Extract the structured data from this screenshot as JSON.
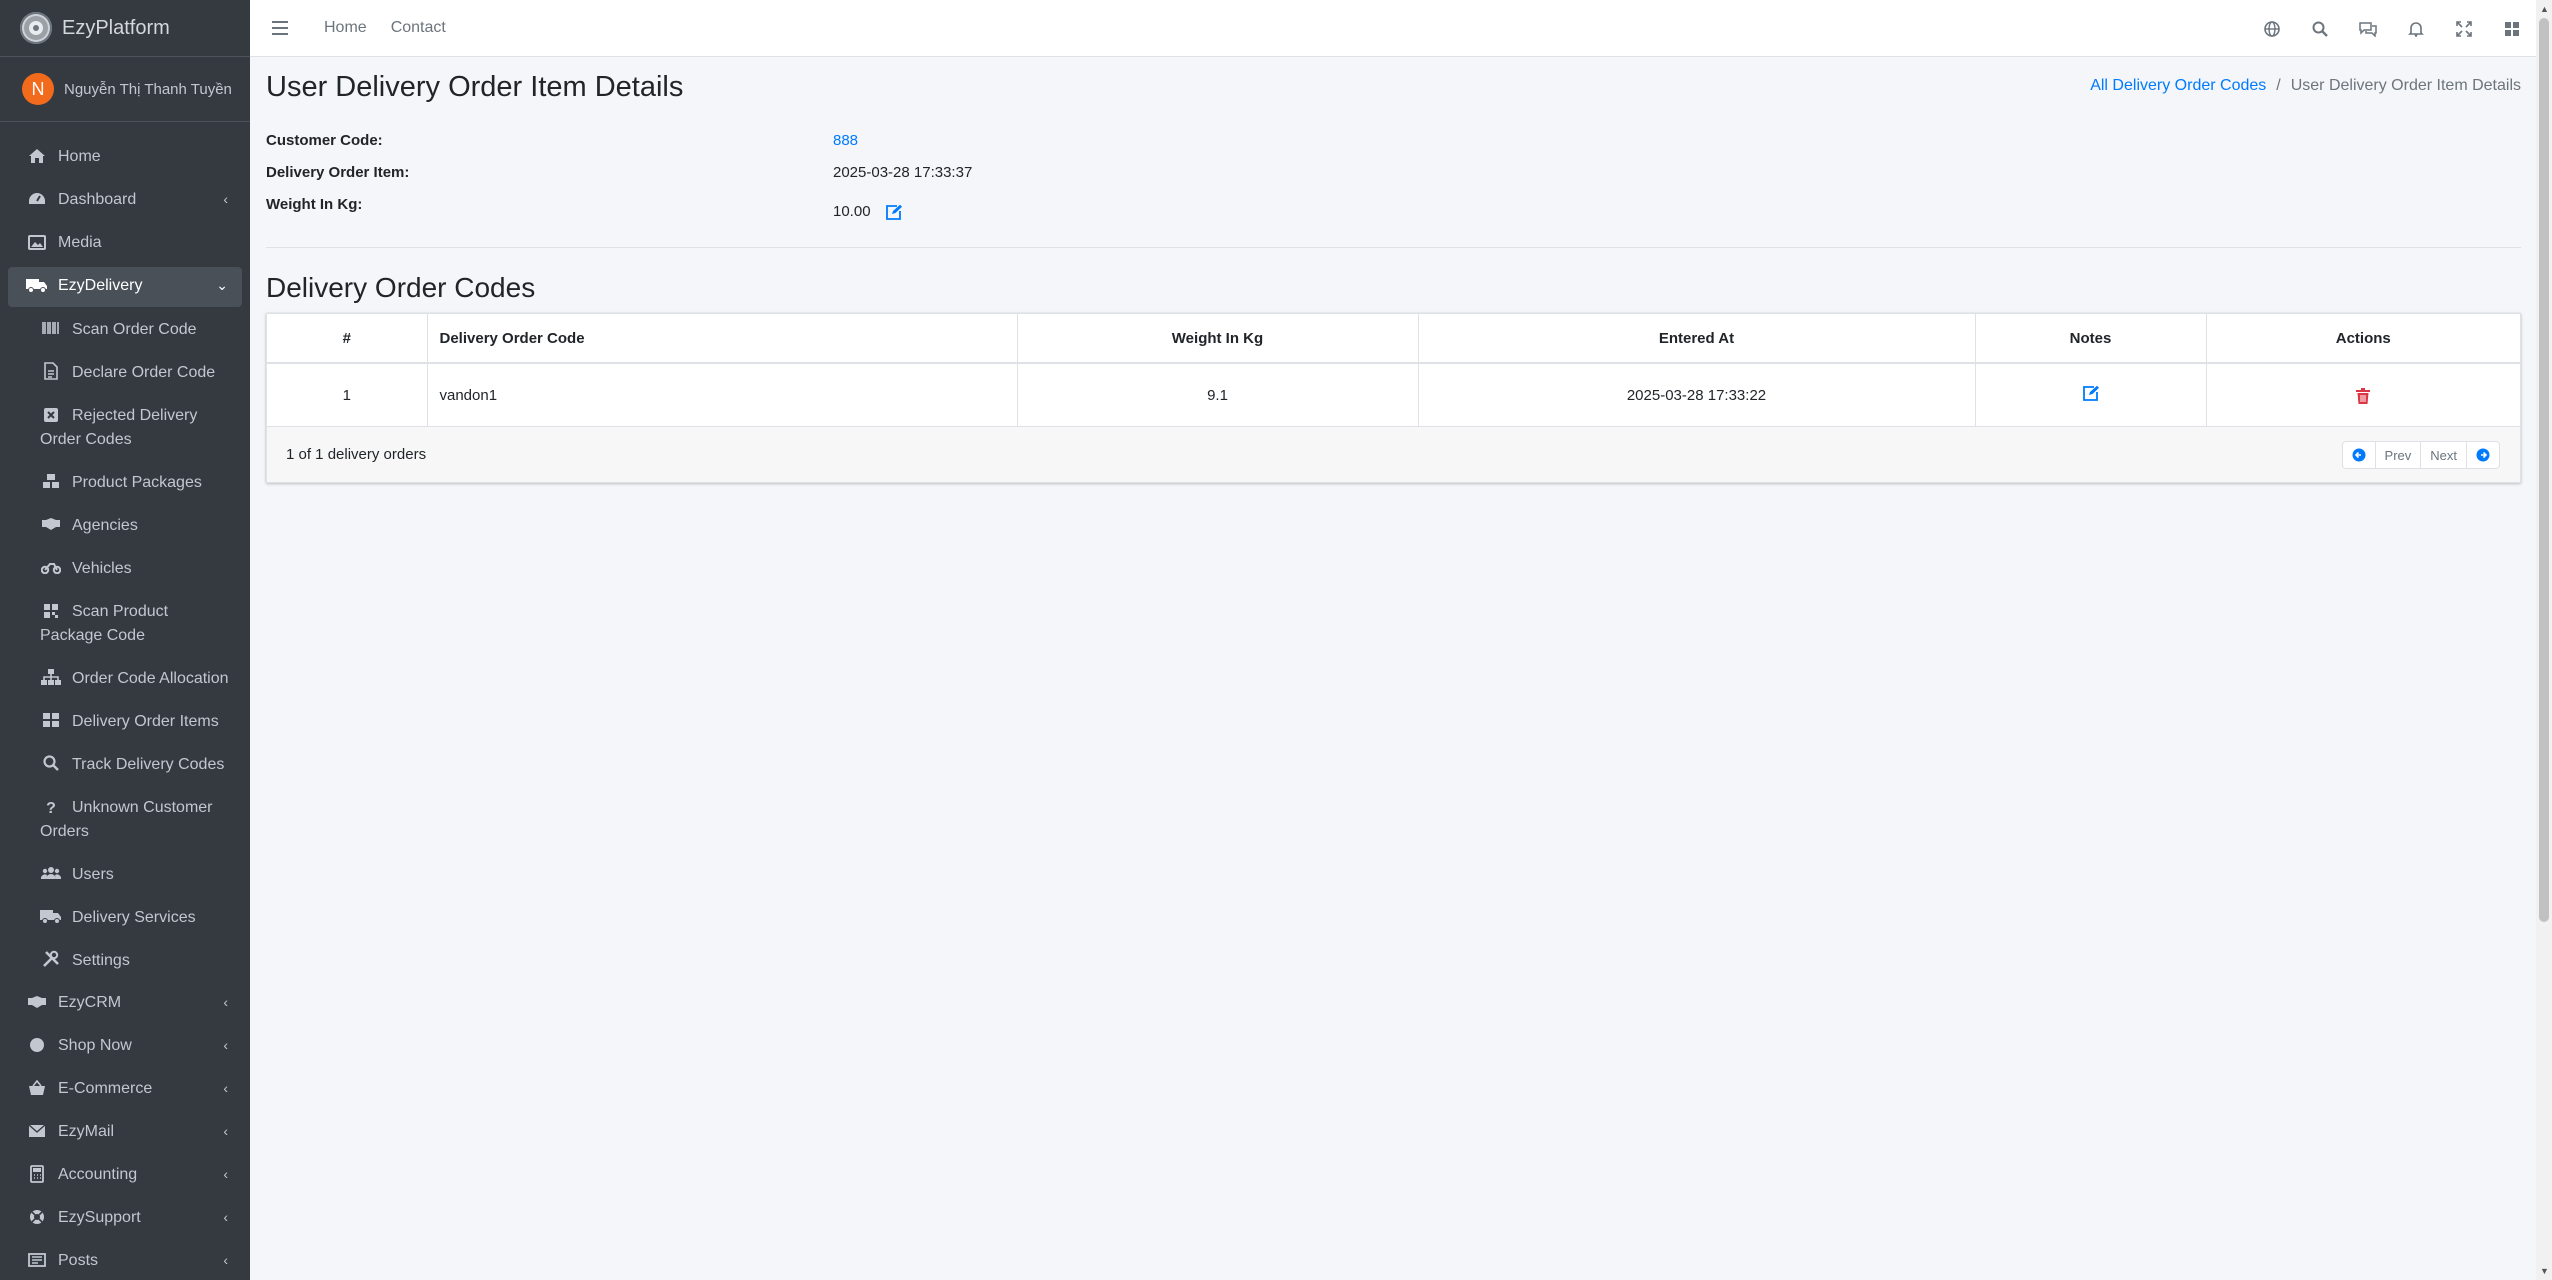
{
  "brand": {
    "name": "EzyPlatform"
  },
  "user": {
    "initial": "N",
    "name": "Nguyễn Thị Thanh Tuyền"
  },
  "sidebar": {
    "items": [
      {
        "label": "Home",
        "icon": "home-icon"
      },
      {
        "label": "Dashboard",
        "icon": "dashboard-icon",
        "expandable": true
      },
      {
        "label": "Media",
        "icon": "image-icon"
      },
      {
        "label": "EzyDelivery",
        "icon": "truck-icon",
        "expanded": true,
        "active": true
      },
      {
        "label": "Scan Order Code",
        "icon": "barcode-icon",
        "sub": true
      },
      {
        "label": "Declare Order Code",
        "icon": "file-icon",
        "sub": true
      },
      {
        "label": "Rejected Delivery Order Codes",
        "icon": "close-box-icon",
        "sub": true
      },
      {
        "label": "Product Packages",
        "icon": "boxes-icon",
        "sub": true
      },
      {
        "label": "Agencies",
        "icon": "handshake-icon",
        "sub": true
      },
      {
        "label": "Vehicles",
        "icon": "motorcycle-icon",
        "sub": true
      },
      {
        "label": "Scan Product Package Code",
        "icon": "qrcode-icon",
        "sub": true
      },
      {
        "label": "Order Code Allocation",
        "icon": "sitemap-icon",
        "sub": true
      },
      {
        "label": "Delivery Order Items",
        "icon": "grid-icon",
        "sub": true
      },
      {
        "label": "Track Delivery Codes",
        "icon": "search-icon",
        "sub": true
      },
      {
        "label": "Unknown Customer Orders",
        "icon": "question-icon",
        "sub": true
      },
      {
        "label": "Users",
        "icon": "users-icon",
        "sub": true
      },
      {
        "label": "Delivery Services",
        "icon": "truck-icon",
        "sub": true
      },
      {
        "label": "Settings",
        "icon": "tools-icon",
        "sub": true
      },
      {
        "label": "EzyCRM",
        "icon": "handshake-icon",
        "expandable": true
      },
      {
        "label": "Shop Now",
        "icon": "circle-icon",
        "expandable": true
      },
      {
        "label": "E-Commerce",
        "icon": "basket-icon",
        "expandable": true
      },
      {
        "label": "EzyMail",
        "icon": "envelope-icon",
        "expandable": true
      },
      {
        "label": "Accounting",
        "icon": "calculator-icon",
        "expandable": true
      },
      {
        "label": "EzySupport",
        "icon": "lifering-icon",
        "expandable": true
      },
      {
        "label": "Posts",
        "icon": "newspaper-icon",
        "expandable": true
      }
    ]
  },
  "topbar": {
    "home": "Home",
    "contact": "Contact"
  },
  "page": {
    "title": "User Delivery Order Item Details",
    "breadcrumb": {
      "parent": "All Delivery Order Codes",
      "separator": "/",
      "current": "User Delivery Order Item Details"
    }
  },
  "details": {
    "customer_code_label": "Customer Code:",
    "customer_code": "888",
    "delivery_order_item_label": "Delivery Order Item:",
    "delivery_order_item": "2025-03-28 17:33:37",
    "weight_label": "Weight In Kg:",
    "weight": "10.00"
  },
  "codes": {
    "title": "Delivery Order Codes",
    "columns": [
      "#",
      "Delivery Order Code",
      "Weight In Kg",
      "Entered At",
      "Notes",
      "Actions"
    ],
    "rows": [
      {
        "index": "1",
        "code": "vandon1",
        "weight": "9.1",
        "entered_at": "2025-03-28 17:33:22"
      }
    ],
    "summary": "1 of 1 delivery orders",
    "pager": {
      "prev": "Prev",
      "next": "Next"
    }
  },
  "colors": {
    "accent": "#007bff",
    "danger": "#dc3545",
    "sidebar": "#343a40"
  }
}
